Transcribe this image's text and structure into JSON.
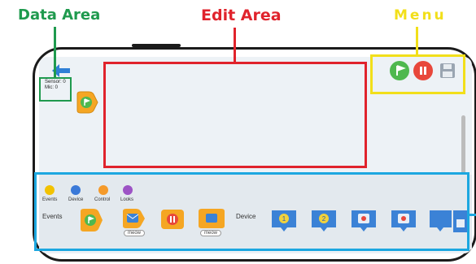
{
  "callouts": {
    "data_area": "Data Area",
    "edit_area": "Edit Area",
    "menu": "Menu"
  },
  "sensor_readout": {
    "sensor": "Sensor: 0",
    "mic": "Mic: 0"
  },
  "colors": {
    "data_box": "#1f9a4e",
    "edit_box": "#e0232c",
    "menu_box": "#f2df1a",
    "palette_box": "#1ca7e0",
    "block_orange": "#f5a623",
    "block_blue": "#3b82d6"
  },
  "menu_icons": [
    "green-flag-icon",
    "stop-icon",
    "save-icon"
  ],
  "categories": [
    {
      "label": "Events",
      "color": "#f2c200"
    },
    {
      "label": "Device",
      "color": "#3a79d8"
    },
    {
      "label": "Control",
      "color": "#f59a2a"
    },
    {
      "label": "Looks",
      "color": "#9d53c5"
    }
  ],
  "palette": {
    "events_label": "Events",
    "device_label": "Device",
    "meow_1": "meow",
    "meow_2": "meow",
    "device_badge_1": "1",
    "device_badge_2": "2"
  }
}
